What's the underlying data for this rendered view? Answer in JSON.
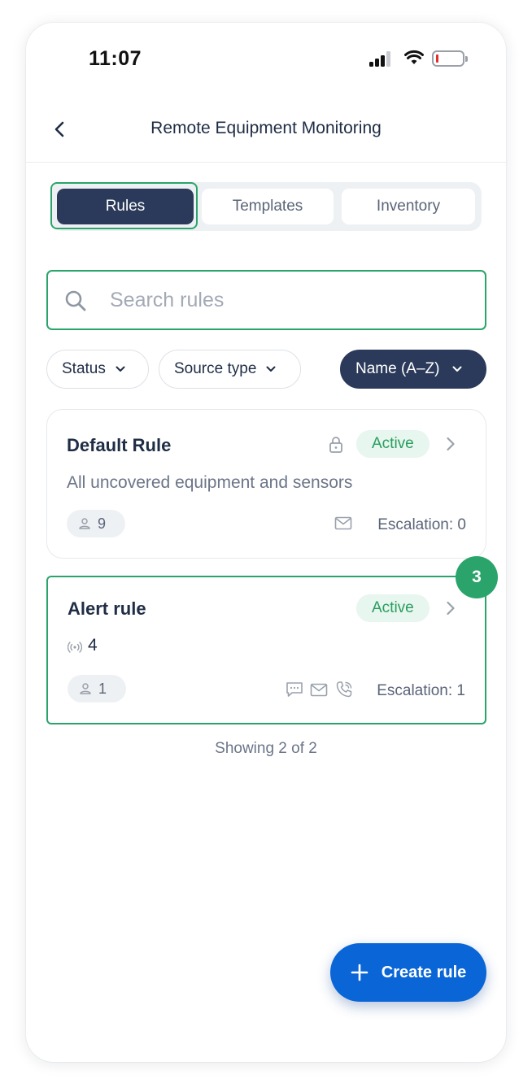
{
  "status_bar": {
    "time": "11:07"
  },
  "header": {
    "title": "Remote Equipment Monitoring",
    "back_icon": "chevron-left-icon"
  },
  "tabs": [
    {
      "label": "Rules",
      "active": true
    },
    {
      "label": "Templates",
      "active": false
    },
    {
      "label": "Inventory",
      "active": false
    }
  ],
  "search": {
    "placeholder": "Search rules",
    "value": ""
  },
  "filters": {
    "status": "Status",
    "source_type": "Source type",
    "sort": "Name (A–Z)"
  },
  "rules": [
    {
      "name": "Default Rule",
      "locked": true,
      "status": "Active",
      "description": "All uncovered equipment and sensors",
      "recipients": "9",
      "channels": [
        "email"
      ],
      "escalation": "Escalation: 0"
    },
    {
      "name": "Alert rule",
      "locked": false,
      "status": "Active",
      "sources": "4",
      "recipients": "1",
      "channels": [
        "sms",
        "email",
        "phone"
      ],
      "escalation": "Escalation: 1"
    }
  ],
  "step_badge": "3",
  "showing": "Showing 2 of 2",
  "fab": {
    "label": "Create rule",
    "icon": "plus-icon"
  },
  "colors": {
    "accent_green": "#2aa46a",
    "navy": "#2b3a5a",
    "primary_blue": "#0a66d6",
    "active_badge": "#e7f6ee"
  }
}
